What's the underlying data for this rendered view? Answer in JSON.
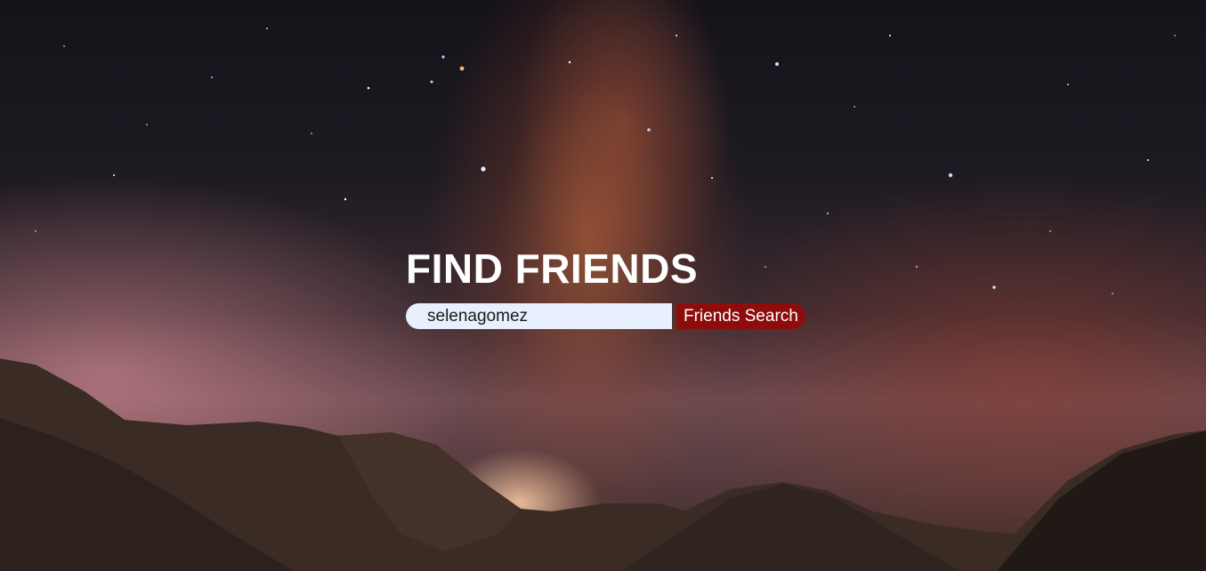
{
  "hero": {
    "title": "FIND FRIENDS"
  },
  "search": {
    "value": "selenagomez",
    "button_label": "Friends Search"
  },
  "colors": {
    "button_bg": "#8e0c0c",
    "input_bg": "#e8f0fe",
    "title_color": "#ffffff"
  }
}
